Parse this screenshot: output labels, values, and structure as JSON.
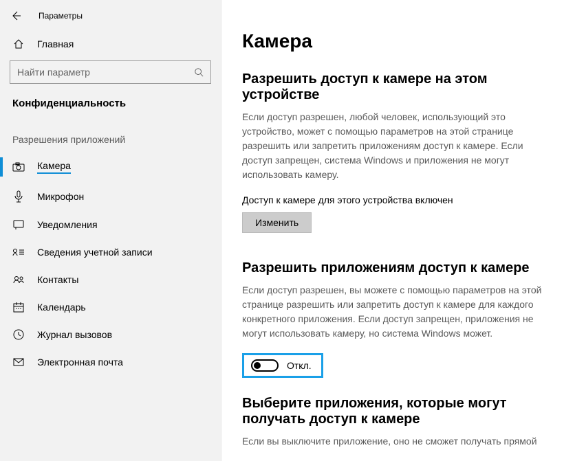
{
  "window": {
    "title": "Параметры"
  },
  "sidebar": {
    "home_label": "Главная",
    "search_placeholder": "Найти параметр",
    "category_label": "Конфиденциальность",
    "section_label": "Разрешения приложений",
    "items": [
      {
        "label": "Камера",
        "icon": "camera-icon",
        "active": true
      },
      {
        "label": "Микрофон",
        "icon": "microphone-icon"
      },
      {
        "label": "Уведомления",
        "icon": "notifications-icon"
      },
      {
        "label": "Сведения учетной записи",
        "icon": "account-info-icon"
      },
      {
        "label": "Контакты",
        "icon": "contacts-icon"
      },
      {
        "label": "Календарь",
        "icon": "calendar-icon"
      },
      {
        "label": "Журнал вызовов",
        "icon": "call-history-icon"
      },
      {
        "label": "Электронная почта",
        "icon": "email-icon"
      }
    ]
  },
  "main": {
    "title": "Камера",
    "sec1": {
      "heading": "Разрешить доступ к камере на этом устройстве",
      "body": "Если доступ разрешен, любой человек, использующий это устройство, может с помощью параметров на этой странице разрешить или запретить приложениям доступ к камере. Если доступ запрещен, система Windows и приложения не могут использовать камеру.",
      "status": "Доступ к камере для этого устройства включен",
      "button": "Изменить"
    },
    "sec2": {
      "heading": "Разрешить приложениям доступ к камере",
      "body": "Если доступ разрешен, вы можете с помощью параметров на этой странице разрешить или запретить доступ к камере для каждого конкретного приложения. Если доступ запрещен, приложения не могут использовать камеру, но система Windows может.",
      "toggle_state": "Откл."
    },
    "sec3": {
      "heading": "Выберите приложения, которые могут получать доступ к камере",
      "body": "Если вы выключите приложение, оно не сможет получать прямой"
    }
  }
}
